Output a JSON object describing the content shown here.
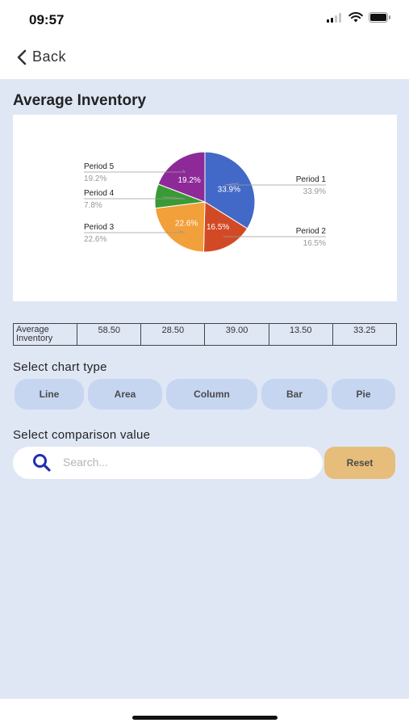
{
  "status": {
    "time": "09:57"
  },
  "nav": {
    "back_label": "Back"
  },
  "page": {
    "title": "Average Inventory"
  },
  "chart_data": {
    "type": "pie",
    "title": "",
    "slices": [
      {
        "label": "Period 1",
        "value": 33.9,
        "display": "33.9%",
        "color": "#4269c8"
      },
      {
        "label": "Period 2",
        "value": 16.5,
        "display": "16.5%",
        "color": "#d24a25"
      },
      {
        "label": "Period 3",
        "value": 22.6,
        "display": "22.6%",
        "color": "#f2a03a"
      },
      {
        "label": "Period 4",
        "value": 7.8,
        "display": "7.8%",
        "color": "#3a9a35"
      },
      {
        "label": "Period 5",
        "value": 19.2,
        "display": "19.2%",
        "color": "#8d2a98"
      }
    ]
  },
  "table": {
    "row_label": "Average Inventory",
    "values": [
      "58.50",
      "28.50",
      "39.00",
      "13.50",
      "33.25"
    ]
  },
  "chart_type": {
    "label": "Select chart type",
    "options": [
      "Line",
      "Area",
      "Column",
      "Bar",
      "Pie"
    ]
  },
  "comparison": {
    "label": "Select comparison value",
    "search_placeholder": "Search...",
    "reset_label": "Reset"
  },
  "colors": {
    "accent": "#1f2fb0",
    "background": "#dfe7f5",
    "button": "#c6d6f0",
    "reset": "#e6bd7a"
  }
}
